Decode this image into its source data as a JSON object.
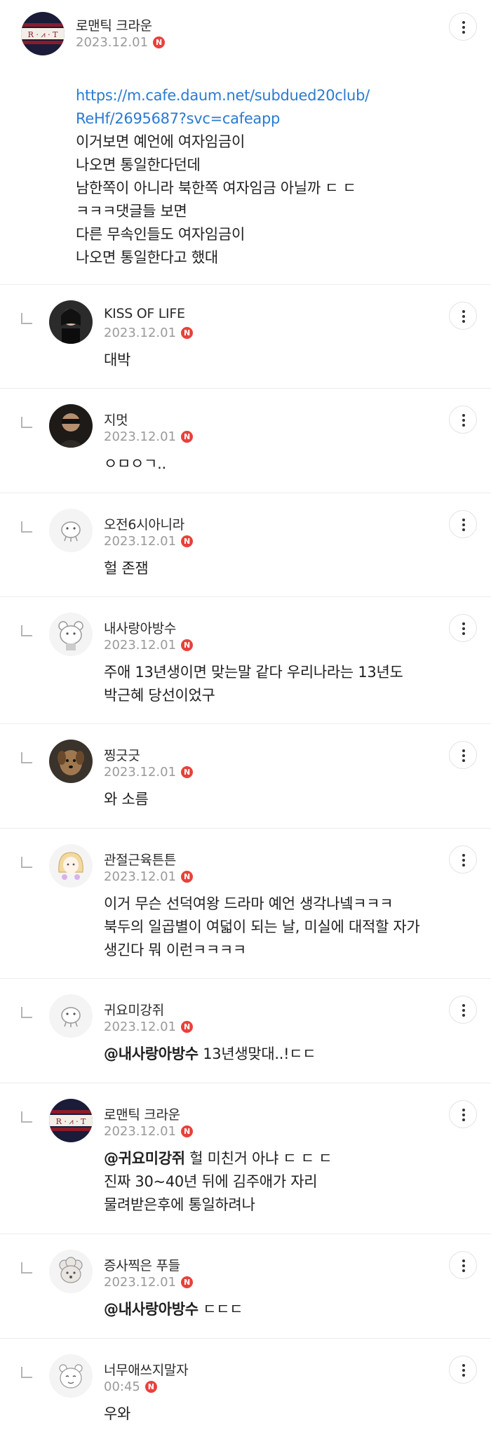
{
  "badge_letter": "N",
  "colors": {
    "badge": "#e8413b",
    "link": "#2a7bd1",
    "date": "#9a9a9a"
  },
  "comments": [
    {
      "nickname": "로맨틱 크라운",
      "date": "2023.12.01",
      "avatar_icon": "rmt-logo-avatar",
      "avatar_text": "R · ⩘ · T",
      "link_line1": "https://m.cafe.daum.net/subdued20club/",
      "link_line2": "ReHf/2695687?svc=cafeapp",
      "text": "이거보면 예언에 여자임금이\n나오면 통일한다던데\n남한쪽이 아니라 북한쪽 여자임금 아닐까 ㄷ ㄷ\nㅋㅋㅋ댓글들 보면\n다른 무속인들도 여자임금이\n나오면 통일한다고 했대"
    },
    {
      "nickname": "KISS OF LIFE",
      "date": "2023.12.01",
      "avatar_icon": "photo-avatar",
      "text": "대박"
    },
    {
      "nickname": "지멋",
      "date": "2023.12.01",
      "avatar_icon": "photo-avatar",
      "text": "ㅇㅁㅇㄱ.."
    },
    {
      "nickname": "오전6시아니라",
      "date": "2023.12.01",
      "avatar_icon": "default-character-avatar",
      "text": "헐 존잼"
    },
    {
      "nickname": "내사랑아방수",
      "date": "2023.12.01",
      "avatar_icon": "bear-character-avatar",
      "text": "주애 13년생이면 맞는말 같다 우리나라는 13년도\n박근혜 당선이었구"
    },
    {
      "nickname": "찡긋긋",
      "date": "2023.12.01",
      "avatar_icon": "dog-photo-avatar",
      "text": "와 소름"
    },
    {
      "nickname": "관절근육튼튼",
      "date": "2023.12.01",
      "avatar_icon": "girl-character-avatar",
      "text": "이거 무슨 선덕여왕 드라마 예언 생각나넼ㅋㅋㅋ\n북두의 일곱별이 여덟이 되는 날, 미실에 대적할 자가\n생긴다 뭐 이런ㅋㅋㅋㅋ"
    },
    {
      "nickname": "귀요미강쥐",
      "date": "2023.12.01",
      "avatar_icon": "default-character-avatar",
      "mention": "@내사랑아방수",
      "text": " 13년생맞대..!ㄷㄷ"
    },
    {
      "nickname": "로맨틱 크라운",
      "date": "2023.12.01",
      "avatar_icon": "rmt-logo-avatar",
      "avatar_text": "R · ⩘ · T",
      "mention": "@귀요미강쥐",
      "text": " 헐 미친거 아냐 ㄷ ㄷ ㄷ\n진짜 30~40년 뒤에 김주애가 자리\n물려받은후에 통일하려나"
    },
    {
      "nickname": "증사찍은 푸들",
      "date": "2023.12.01",
      "avatar_icon": "poodle-character-avatar",
      "mention": "@내사랑아방수",
      "text": " ㄷㄷㄷ"
    },
    {
      "nickname": "너무애쓰지말자",
      "date": "00:45",
      "avatar_icon": "hamster-character-avatar",
      "text": "우와"
    }
  ]
}
